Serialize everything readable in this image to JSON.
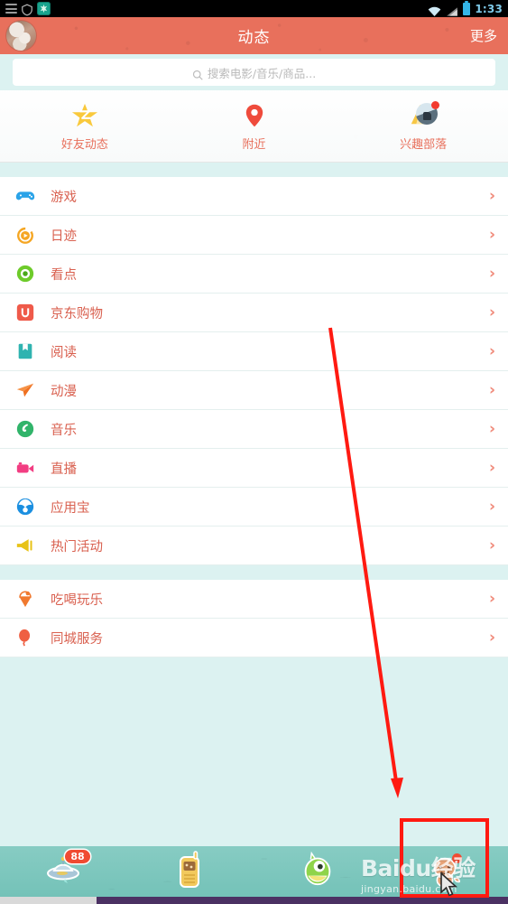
{
  "statusbar": {
    "time": "1:33",
    "icons": [
      "menu-lines-icon",
      "shield-icon",
      "green-app-icon",
      "wifi-icon",
      "signal-icon",
      "battery-icon"
    ]
  },
  "header": {
    "title": "动态",
    "more_label": "更多",
    "avatar_name": "user-avatar",
    "bg_color": "#e8705c"
  },
  "search": {
    "placeholder": "搜索电影/音乐/商品..."
  },
  "quick_actions": [
    {
      "label": "好友动态",
      "icon": "star-icon",
      "badge": false
    },
    {
      "label": "附近",
      "icon": "location-pin-icon",
      "badge": false
    },
    {
      "label": "兴趣部落",
      "icon": "tent-icon",
      "badge": true
    }
  ],
  "list_sections": [
    {
      "items": [
        {
          "label": "游戏",
          "icon": "gamepad-icon",
          "color": "#2aa3e8"
        },
        {
          "label": "日迹",
          "icon": "play-circle-icon",
          "color": "#f5a623"
        },
        {
          "label": "看点",
          "icon": "target-circle-icon",
          "color": "#6ecb2b"
        },
        {
          "label": "京东购物",
          "icon": "jd-square-icon",
          "color": "#ef5a4a"
        },
        {
          "label": "阅读",
          "icon": "book-icon",
          "color": "#2fb3b0"
        },
        {
          "label": "动漫",
          "icon": "paper-plane-icon",
          "color": "#f07c35"
        },
        {
          "label": "音乐",
          "icon": "music-globe-icon",
          "color": "#31b46a"
        },
        {
          "label": "直播",
          "icon": "video-camera-icon",
          "color": "#f23d82"
        },
        {
          "label": "应用宝",
          "icon": "app-treasure-icon",
          "color": "#1b8fe0"
        },
        {
          "label": "热门活动",
          "icon": "megaphone-icon",
          "color": "#e8c317"
        }
      ]
    },
    {
      "items": [
        {
          "label": "吃喝玩乐",
          "icon": "ice-cream-icon",
          "color": "#f0792f"
        },
        {
          "label": "同城服务",
          "icon": "balloon-icon",
          "color": "#ef5f42"
        }
      ]
    }
  ],
  "chevron": "›",
  "bottom_nav": [
    {
      "name": "ufo",
      "badge": "88",
      "badge_type": "count"
    },
    {
      "name": "phone",
      "badge": null,
      "badge_type": null
    },
    {
      "name": "monster",
      "badge": null,
      "badge_type": null
    },
    {
      "name": "profile",
      "badge": "",
      "badge_type": "dot"
    }
  ],
  "watermark": {
    "big": "Baidu经验",
    "small": "jingyan.baidu.com"
  },
  "annotation": {
    "arrow_color": "#ff1a11",
    "rect_color": "#ff1a11"
  }
}
